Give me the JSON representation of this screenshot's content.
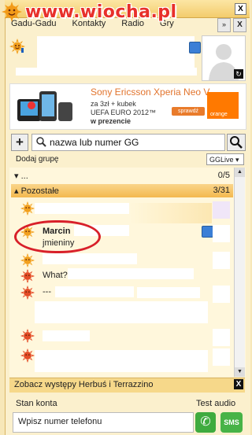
{
  "watermark": {
    "text": "www.wiocha.pl"
  },
  "menu": {
    "items": [
      "Gadu-Gadu",
      "Kontakty",
      "Radio",
      "Gry"
    ],
    "more_label": "»",
    "close_label": "X"
  },
  "window": {
    "close_label": "X"
  },
  "ad": {
    "title": "Sony Ericsson Xperia Neo V",
    "line1": "za 3zł + kubek",
    "line2": "UEFA EURO 2012™",
    "line3": "w prezencie",
    "button": "sprawdź",
    "brand": "orange"
  },
  "search": {
    "placeholder": "nazwa lub numer GG",
    "add_label": "+"
  },
  "toolbar": {
    "add_group": "Dodaj grupę",
    "gglive": "GGLive"
  },
  "groups": [
    {
      "name": "...",
      "count": "0/5"
    },
    {
      "name": "Pozostałe",
      "count": "3/31"
    }
  ],
  "contacts": [
    {
      "name": "Marcin",
      "desc": "jmieniny"
    },
    {
      "name": "",
      "desc": "What?"
    },
    {
      "name": "",
      "desc": "---"
    }
  ],
  "promo": {
    "text": "Zobacz występy Herbuś i Terrazzino",
    "close_label": "X"
  },
  "bottom": {
    "account_status": "Stan konta",
    "test_audio": "Test audio",
    "phone_placeholder": "Wpisz numer telefonu",
    "sms_label": "SMS"
  },
  "colors": {
    "accent": "#f3b84e",
    "highlight_oval": "#d8202a",
    "status_online": "#f2a01e",
    "status_busy": "#e44b26"
  }
}
